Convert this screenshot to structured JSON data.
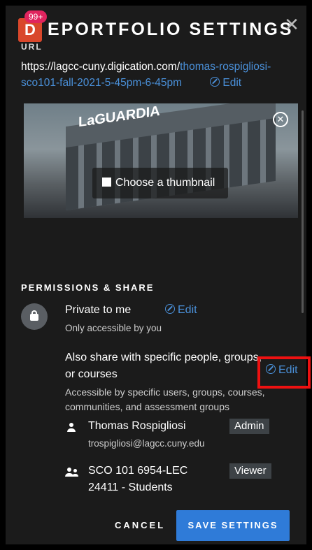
{
  "header": {
    "app_logo_letter": "D",
    "notification_badge": "99+",
    "title": "EPORTFOLIO SETTINGS"
  },
  "url_section": {
    "label": "URL",
    "base": "https://lagcc-cuny.digication.com/",
    "slug": "thomas-rospigliosi-sco101-fall-2021-5-45pm-6-45pm",
    "edit_label": "Edit"
  },
  "thumbnail": {
    "sign_text": "LaGUARDIA",
    "choose_label": "Choose a thumbnail"
  },
  "permissions": {
    "title": "PERMISSIONS & SHARE",
    "privacy": {
      "label": "Private to me",
      "description": "Only accessible by you",
      "edit_label": "Edit"
    },
    "sharing": {
      "label": "Also share with specific people, groups, or courses",
      "description": "Accessible by specific users, groups, courses, communities, and assessment groups",
      "edit_label": "Edit"
    },
    "members": [
      {
        "name": "Thomas Rospigliosi",
        "detail": "trospigliosi@lagcc.cuny.edu",
        "role": "Admin",
        "icon": "person-icon"
      },
      {
        "name": "SCO 101 6954-LEC",
        "detail": "24411 - Students",
        "role": "Viewer",
        "icon": "group-icon"
      }
    ]
  },
  "footer": {
    "cancel_label": "CANCEL",
    "save_label": "SAVE SETTINGS"
  },
  "colors": {
    "accent": "#2f7bd8",
    "link": "#4a90d9",
    "logo": "#d9472b",
    "badge": "#e0245e",
    "highlight": "#e11111"
  }
}
